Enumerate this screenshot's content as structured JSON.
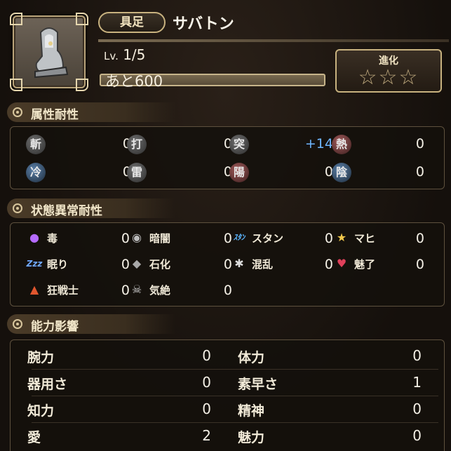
{
  "header": {
    "category": "具足",
    "name": "サバトン",
    "level_label": "Lv.",
    "level_value": "1/5",
    "next_label": "あと600",
    "exp_progress": 0.0,
    "evolution_label": "進化",
    "stars": "☆☆☆",
    "evolution_stars": 0
  },
  "element_resist": {
    "title": "属性耐性",
    "items": [
      {
        "icon": "slash-icon",
        "glyph": "斬",
        "value": "0"
      },
      {
        "icon": "strike-icon",
        "glyph": "打",
        "value": "0"
      },
      {
        "icon": "pierce-icon",
        "glyph": "突",
        "value": "+14"
      },
      {
        "icon": "heat-icon",
        "glyph": "熱",
        "value": "0"
      },
      {
        "icon": "cold-icon",
        "glyph": "冷",
        "value": "0"
      },
      {
        "icon": "thunder-icon",
        "glyph": "雷",
        "value": "0"
      },
      {
        "icon": "yang-icon",
        "glyph": "陽",
        "value": "0"
      },
      {
        "icon": "yin-icon",
        "glyph": "陰",
        "value": "0"
      }
    ]
  },
  "status_resist": {
    "title": "状態異常耐性",
    "items": [
      {
        "icon": "poison-icon",
        "glyph": "●",
        "label": "毒",
        "value": "0"
      },
      {
        "icon": "darkness-icon",
        "glyph": "◉",
        "label": "暗闇",
        "value": "0"
      },
      {
        "icon": "stun-icon",
        "glyph": "ｽﾀﾝ",
        "label": "スタン",
        "value": "0"
      },
      {
        "icon": "paralysis-icon",
        "glyph": "★",
        "label": "マヒ",
        "value": "0"
      },
      {
        "icon": "sleep-icon",
        "glyph": "Zzz",
        "label": "眠り",
        "value": "0"
      },
      {
        "icon": "petrify-icon",
        "glyph": "◆",
        "label": "石化",
        "value": "0"
      },
      {
        "icon": "confusion-icon",
        "glyph": "✱",
        "label": "混乱",
        "value": "0"
      },
      {
        "icon": "charm-icon",
        "glyph": "♥",
        "label": "魅了",
        "value": "0"
      },
      {
        "icon": "berserk-icon",
        "glyph": "▲",
        "label": "狂戦士",
        "value": "0"
      },
      {
        "icon": "faint-icon",
        "glyph": "☠",
        "label": "気絶",
        "value": "0"
      }
    ]
  },
  "abilities": {
    "title": "能力影響",
    "rows": [
      {
        "left_label": "腕力",
        "left_value": "0",
        "right_label": "体力",
        "right_value": "0"
      },
      {
        "left_label": "器用さ",
        "left_value": "0",
        "right_label": "素早さ",
        "right_value": "1"
      },
      {
        "left_label": "知力",
        "left_value": "0",
        "right_label": "精神",
        "right_value": "0"
      },
      {
        "left_label": "愛",
        "left_value": "2",
        "right_label": "魅力",
        "right_value": "0"
      }
    ]
  },
  "colors": {
    "accent_gold": "#c8b27f",
    "positive_blue": "#6fb7ff"
  }
}
